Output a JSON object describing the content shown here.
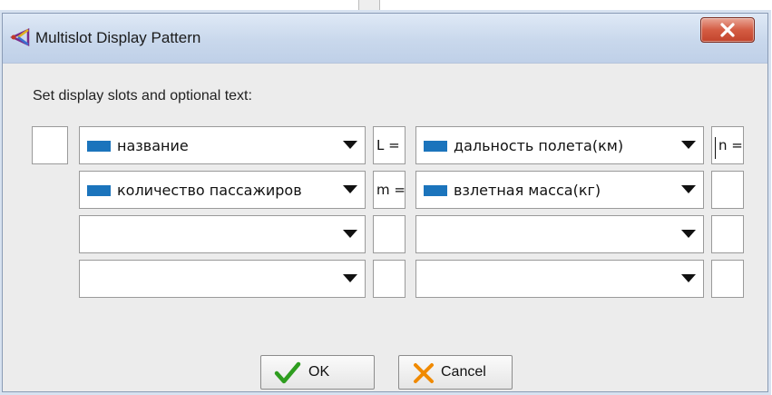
{
  "window": {
    "title": "Multislot Display Pattern"
  },
  "prompt": "Set display slots and optional text:",
  "rows": [
    {
      "left_slot": "название",
      "mid_text": "L =",
      "right_slot": "дальность полета(км)",
      "end_text": "n ="
    },
    {
      "left_slot": "количество пассажиров",
      "mid_text": "m =",
      "right_slot": "взлетная масса(кг)",
      "end_text": ""
    },
    {
      "left_slot": "",
      "mid_text": "",
      "right_slot": "",
      "end_text": ""
    },
    {
      "left_slot": "",
      "mid_text": "",
      "right_slot": "",
      "end_text": ""
    }
  ],
  "buttons": {
    "ok": "OK",
    "cancel": "Cancel"
  },
  "colors": {
    "slot_chip": "#1b74bc",
    "ok_check": "#2e9d1f",
    "cancel_x": "#f08a00",
    "close_button": "#c94d33"
  },
  "icons": {
    "title": "multislot-app-icon",
    "close": "close-icon",
    "dropdown": "chevron-down-icon",
    "ok": "check-icon",
    "cancel": "x-icon"
  }
}
